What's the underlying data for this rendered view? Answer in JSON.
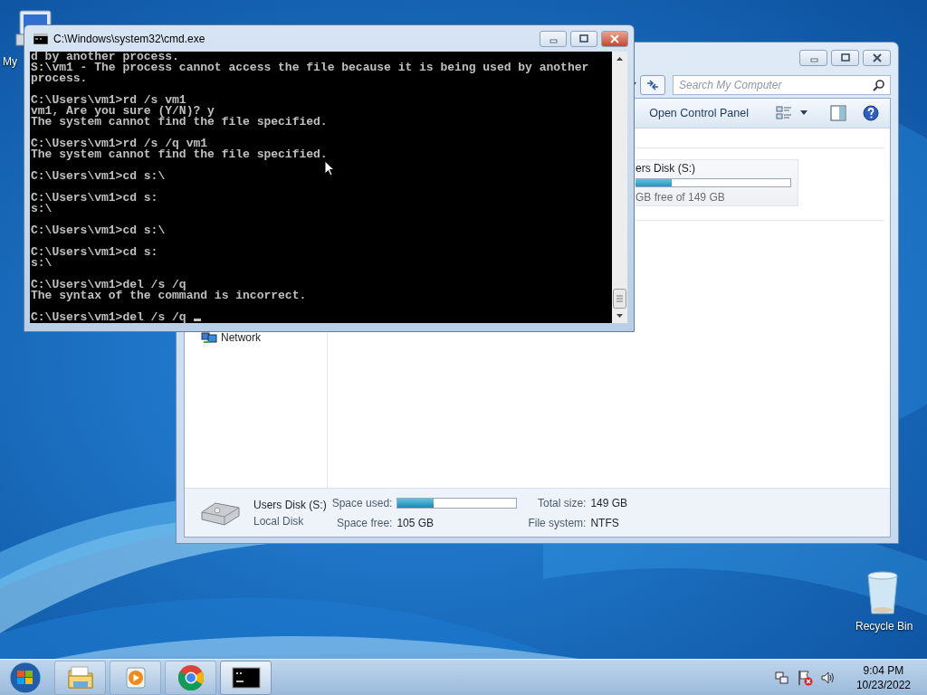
{
  "desktop_icons": [
    {
      "kind": "computer",
      "label": "My"
    },
    {
      "kind": "recycle",
      "label": "Recycle Bin"
    }
  ],
  "explorer": {
    "search": {
      "placeholder": "Search My Computer"
    },
    "command_bar": [
      "Open Control Panel"
    ],
    "sidebar": {
      "items": [
        {
          "label": "Network"
        }
      ]
    },
    "drive_tile": {
      "name": "ers Disk (S:)",
      "level": 0.3,
      "free": "GB free of 149 GB"
    },
    "details": {
      "name": "Users Disk (S:)",
      "type": "Local Disk",
      "space_used_label": "Space used:",
      "level": 0.3,
      "space_free_label": "Space free:",
      "space_free": "105 GB",
      "total_size_label": "Total size:",
      "total_size": "149 GB",
      "file_system_label": "File system:",
      "file_system": "NTFS"
    }
  },
  "cmd": {
    "title": "C:\\Windows\\system32\\cmd.exe",
    "cursor_visible": true,
    "blocks": [
      [
        "d by another process.",
        "S:\\vm1 - The process cannot access the file because it is being used by another",
        "process."
      ],
      [
        "C:\\Users\\vm1>rd /s vm1",
        "vm1, Are you sure (Y/N)? y",
        "The system cannot find the file specified."
      ],
      [
        "C:\\Users\\vm1>rd /s /q vm1",
        "The system cannot find the file specified."
      ],
      [
        "C:\\Users\\vm1>cd s:\\"
      ],
      [
        "C:\\Users\\vm1>cd s:",
        "s:\\"
      ],
      [
        "C:\\Users\\vm1>cd s:\\"
      ],
      [
        "C:\\Users\\vm1>cd s:",
        "s:\\"
      ],
      [
        "C:\\Users\\vm1>del /s /q",
        "The syntax of the command is incorrect."
      ],
      [
        "C:\\Users\\vm1>del /s /q"
      ]
    ]
  },
  "taskbar": {
    "items": [
      {
        "kind": "explorer",
        "selected": false
      },
      {
        "kind": "media",
        "selected": false
      },
      {
        "kind": "chrome",
        "selected": false
      },
      {
        "kind": "console",
        "selected": true
      }
    ],
    "clock": {
      "time": "9:04 PM",
      "date": "10/23/2022"
    }
  }
}
